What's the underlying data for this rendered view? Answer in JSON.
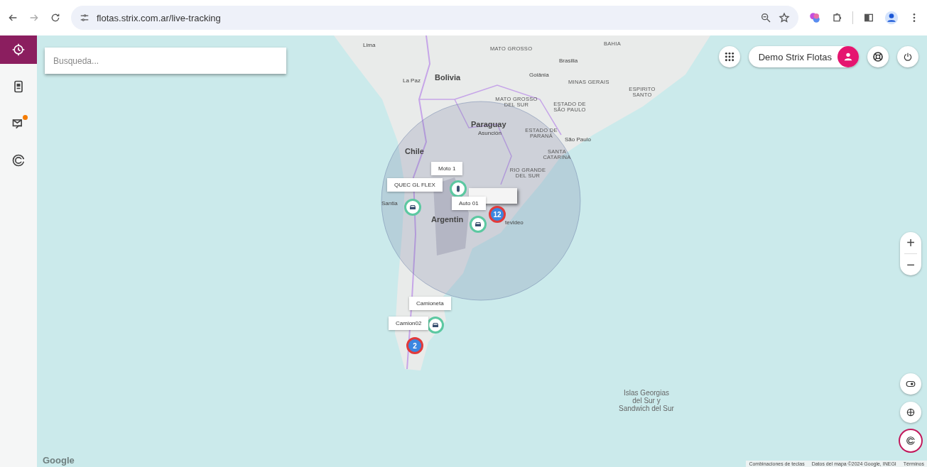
{
  "browser": {
    "url": "flotas.strix.com.ar/live-tracking"
  },
  "sidebar": {
    "items": [
      {
        "kind": "tracking",
        "selected": true,
        "notification": false
      },
      {
        "kind": "device",
        "selected": false,
        "notification": false
      },
      {
        "kind": "messages",
        "selected": false,
        "notification": true
      },
      {
        "kind": "geofence",
        "selected": false,
        "notification": false
      }
    ]
  },
  "search": {
    "placeholder": "Busqueda..."
  },
  "user": {
    "name": "Demo Strix Flotas"
  },
  "map": {
    "labels": [
      {
        "kind": "city",
        "text": "Lima"
      },
      {
        "kind": "city",
        "text": "La Paz"
      },
      {
        "kind": "country",
        "text": "Bolivia"
      },
      {
        "kind": "state",
        "text": "MATO GROSSO"
      },
      {
        "kind": "city",
        "text": "Brasilia"
      },
      {
        "kind": "city",
        "text": "Goiânia"
      },
      {
        "kind": "state",
        "text": "MINAS GERAIS"
      },
      {
        "kind": "state",
        "text": "BAHIA"
      },
      {
        "kind": "state",
        "text": "ESPIRITO SANTO"
      },
      {
        "kind": "state",
        "text": "MATO GROSSO DEL SUR"
      },
      {
        "kind": "state",
        "text": "ESTADO DE SÃO PAULO"
      },
      {
        "kind": "country",
        "text": "Paraguay"
      },
      {
        "kind": "city",
        "text": "Asunción"
      },
      {
        "kind": "state",
        "text": "ESTADO DE PARANÁ"
      },
      {
        "kind": "city",
        "text": "São Paulo"
      },
      {
        "kind": "country",
        "text": "Chile"
      },
      {
        "kind": "state",
        "text": "SANTA CATARINA"
      },
      {
        "kind": "state",
        "text": "RIO GRANDE DEL SUR"
      },
      {
        "kind": "city",
        "text": "Santia"
      },
      {
        "kind": "country",
        "text": "Argentin"
      },
      {
        "kind": "city",
        "text": "tevideo"
      },
      {
        "kind": "region",
        "text": "Islas Georgias del Sur y Sandwich del Sur"
      }
    ],
    "markers": [
      {
        "kind": "vehicle",
        "label": "QUEC GL FLEX"
      },
      {
        "kind": "moto",
        "label": "Moto 1"
      },
      {
        "kind": "vehicle",
        "label": "Auto 01"
      },
      {
        "kind": "cluster",
        "count": "12"
      },
      {
        "kind": "vehicle",
        "label": "Camioneta"
      },
      {
        "kind": "cluster",
        "count": "2",
        "label": "Camion02"
      }
    ],
    "zoom": {
      "in": "+",
      "out": "−"
    },
    "tools": [
      {
        "kind": "toggle",
        "selected": false
      },
      {
        "kind": "layers",
        "selected": false
      },
      {
        "kind": "geofence",
        "selected": true
      }
    ],
    "logo": "Google",
    "attribution": [
      "Combinaciones de teclas",
      "Datos del mapa ©2024 Google, INEGI",
      "Términos"
    ]
  }
}
